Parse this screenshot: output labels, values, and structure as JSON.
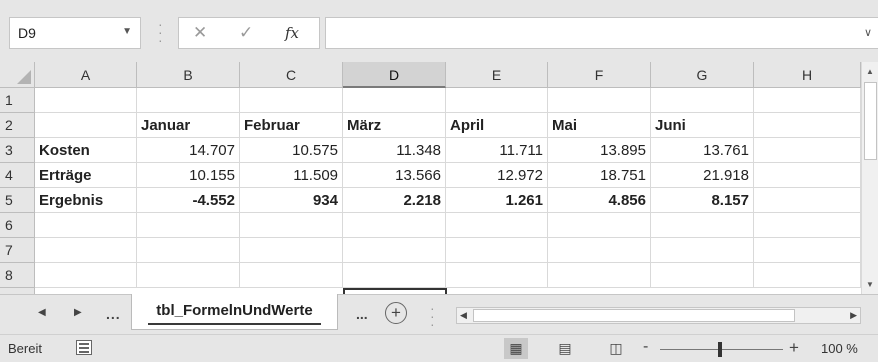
{
  "formula_bar": {
    "name_box_value": "D9",
    "cancel_icon": "close-icon",
    "enter_icon": "check-icon",
    "function_label": "fx",
    "formula_value": ""
  },
  "columns": [
    "A",
    "B",
    "C",
    "D",
    "E",
    "F",
    "G",
    "H"
  ],
  "selected_column": "D",
  "rows": [
    {
      "num": "1",
      "cells": [
        "",
        "",
        "",
        "",
        "",
        "",
        "",
        ""
      ]
    },
    {
      "num": "2",
      "cells": [
        "",
        "Januar",
        "Februar",
        "März",
        "April",
        "Mai",
        "Juni",
        ""
      ]
    },
    {
      "num": "3",
      "cells": [
        "Kosten",
        "14.707",
        "10.575",
        "11.348",
        "11.711",
        "13.895",
        "13.761",
        ""
      ]
    },
    {
      "num": "4",
      "cells": [
        "Erträge",
        "10.155",
        "11.509",
        "13.566",
        "12.972",
        "18.751",
        "21.918",
        ""
      ]
    },
    {
      "num": "5",
      "cells": [
        "Ergebnis",
        "-4.552",
        "934",
        "2.218",
        "1.261",
        "4.856",
        "8.157",
        ""
      ]
    },
    {
      "num": "6",
      "cells": [
        "",
        "",
        "",
        "",
        "",
        "",
        "",
        ""
      ]
    },
    {
      "num": "7",
      "cells": [
        "",
        "",
        "",
        "",
        "",
        "",
        "",
        ""
      ]
    },
    {
      "num": "8",
      "cells": [
        "",
        "",
        "",
        "",
        "",
        "",
        "",
        ""
      ]
    }
  ],
  "sheet_tabs": {
    "nav_more": "...",
    "active_tab": "tbl_FormelnUndWerte",
    "more_after": "...",
    "add_label": "+"
  },
  "status_bar": {
    "ready_text": "Bereit",
    "zoom_minus": "-",
    "zoom_plus": "+",
    "zoom_value": "100 %"
  }
}
